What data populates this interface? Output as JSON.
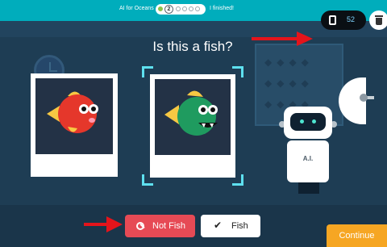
{
  "header": {
    "title": "AI for Oceans",
    "current_level": "2",
    "finished_label": "I finished!"
  },
  "question": "Is this a fish?",
  "counter": {
    "value": "52",
    "icon": "phone-icon"
  },
  "robot": {
    "label": "A.I."
  },
  "buttons": {
    "not_fish_label": "Not Fish",
    "fish_label": "Fish",
    "continue_label": "Continue"
  },
  "colors": {
    "header_bg": "#00adbc",
    "scene_bg": "#1e3d54",
    "not_fish": "#e64a55",
    "continue": "#f6a623",
    "frame": "#5ee0ef",
    "annotation_arrow": "#e4141b"
  }
}
